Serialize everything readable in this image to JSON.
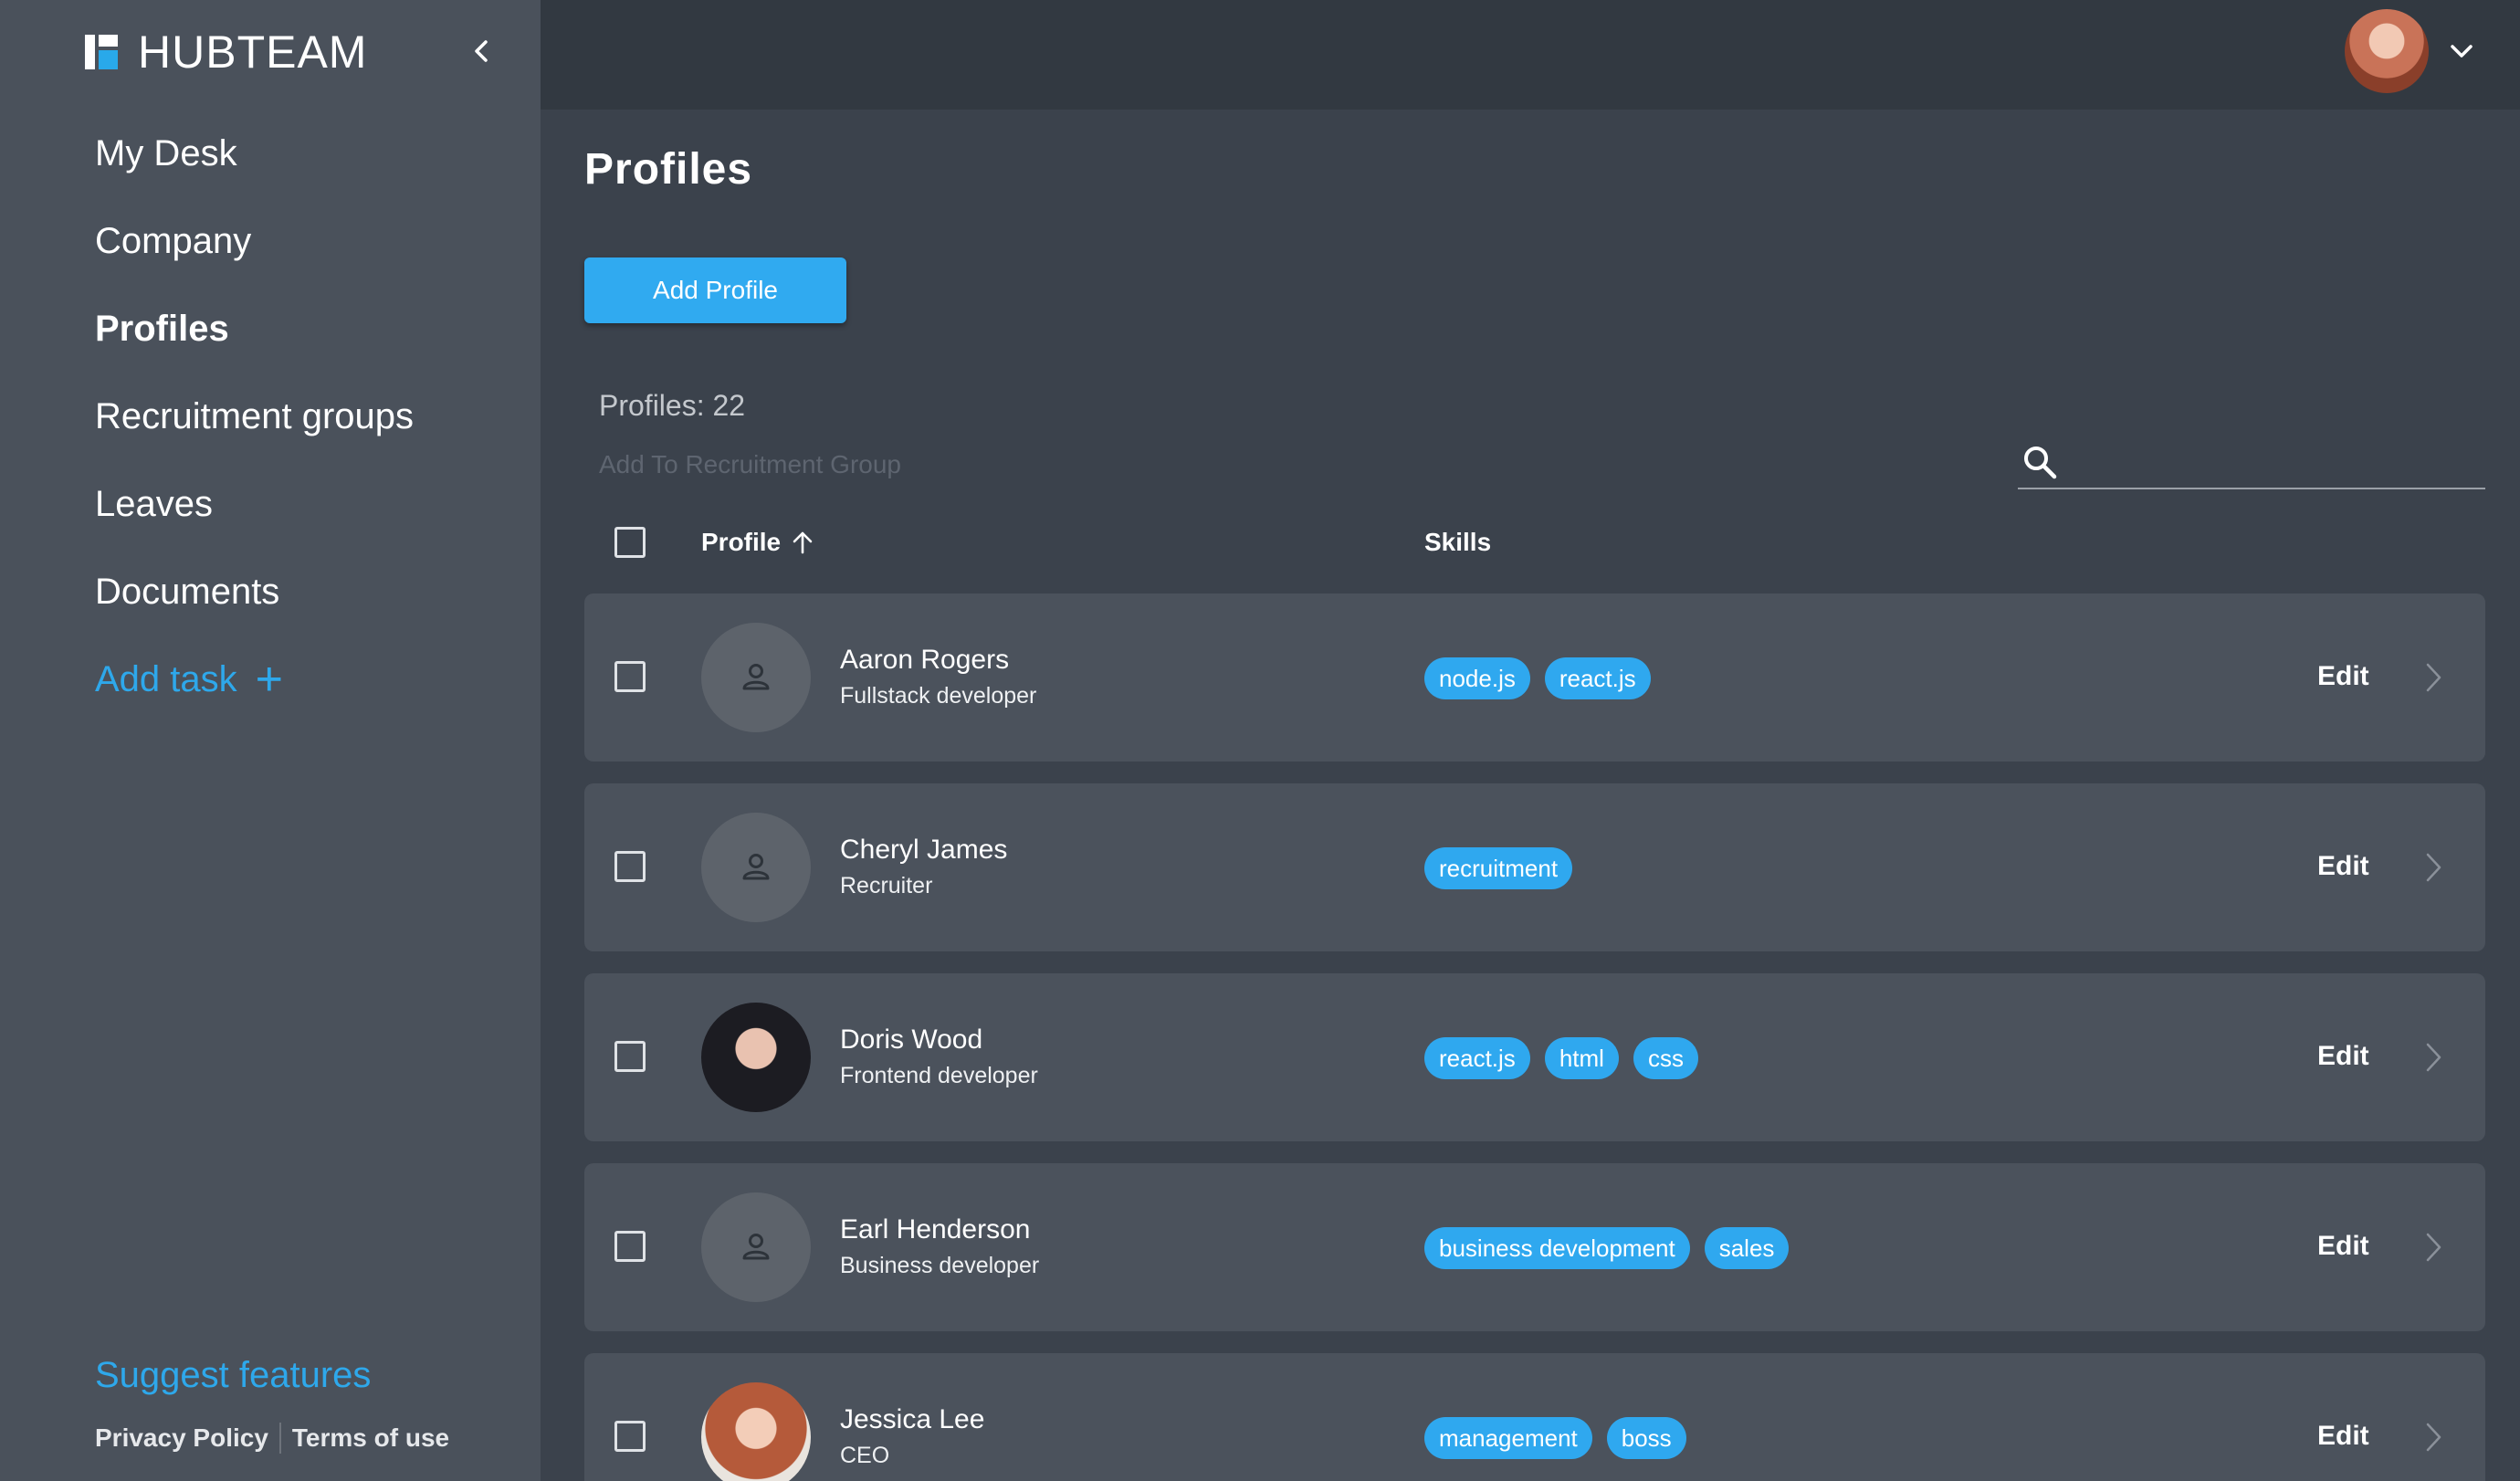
{
  "app": {
    "name": "HUBTEAM"
  },
  "sidebar": {
    "items": [
      {
        "label": "My Desk",
        "active": false
      },
      {
        "label": "Company",
        "active": false
      },
      {
        "label": "Profiles",
        "active": true
      },
      {
        "label": "Recruitment groups",
        "active": false
      },
      {
        "label": "Leaves",
        "active": false
      },
      {
        "label": "Documents",
        "active": false
      }
    ],
    "add_task": "Add task",
    "add_task_icon": "plus-icon",
    "suggest": "Suggest features",
    "privacy": "Privacy Policy",
    "terms": "Terms of use"
  },
  "main": {
    "title": "Profiles",
    "add_button": "Add Profile",
    "count": "Profiles: 22",
    "add_to_group": "Add To Recruitment Group",
    "search": {
      "placeholder": "",
      "value": ""
    },
    "table": {
      "col_profile": "Profile",
      "col_skills": "Skills",
      "sort": "ascending",
      "edit_label": "Edit",
      "rows": [
        {
          "name": "Aaron Rogers",
          "role": "Fullstack developer",
          "avatar": "person-icon",
          "skills": [
            "node.js",
            "react.js"
          ]
        },
        {
          "name": "Cheryl James",
          "role": "Recruiter",
          "avatar": "person-icon",
          "skills": [
            "recruitment"
          ]
        },
        {
          "name": "Doris Wood",
          "role": "Frontend developer",
          "avatar": "photo",
          "skills": [
            "react.js",
            "html",
            "css"
          ]
        },
        {
          "name": "Earl Henderson",
          "role": "Business developer",
          "avatar": "person-icon",
          "skills": [
            "business development",
            "sales"
          ]
        },
        {
          "name": "Jessica Lee",
          "role": "CEO",
          "avatar": "photo",
          "skills": [
            "management",
            "boss"
          ]
        }
      ]
    }
  },
  "colors": {
    "accent": "#2ea8eb",
    "sidebar_bg": "#4a515b",
    "topbar_bg": "#323941",
    "main_bg": "#3b424c",
    "row_bg": "#4b525c"
  }
}
